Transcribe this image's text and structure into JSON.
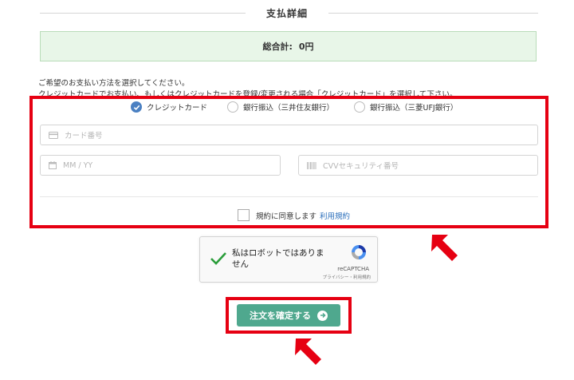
{
  "section": {
    "title": "支払詳細"
  },
  "total": {
    "label": "総合計:",
    "value": "0円"
  },
  "instructions": {
    "line1": "ご希望のお支払い方法を選択してください。",
    "line2": "クレジットカードでお支払い、もしくはクレジットカードを登録/変更される場合「クレジットカード」を選択して下さい。"
  },
  "payment_methods": [
    {
      "label": "クレジットカード",
      "selected": true
    },
    {
      "label": "銀行振込（三井住友銀行）",
      "selected": false
    },
    {
      "label": "銀行振込（三菱UFJ銀行）",
      "selected": false
    }
  ],
  "card_form": {
    "card_number_placeholder": "カード番号",
    "expiry_placeholder": "MM / YY",
    "cvv_placeholder": "CVVセキュリティ番号"
  },
  "terms": {
    "text": "規約に同意します",
    "link": "利用規約"
  },
  "recaptcha": {
    "label": "私はロボットではありません",
    "brand": "reCAPTCHA",
    "privacy": "プライバシー・利用規約"
  },
  "submit": {
    "label": "注文を確定する"
  },
  "colors": {
    "highlight": "#e60012",
    "button": "#4fa88e",
    "radio_selected": "#4a80c2",
    "total_bg": "#e8f6e8",
    "link": "#2a6ebb"
  }
}
